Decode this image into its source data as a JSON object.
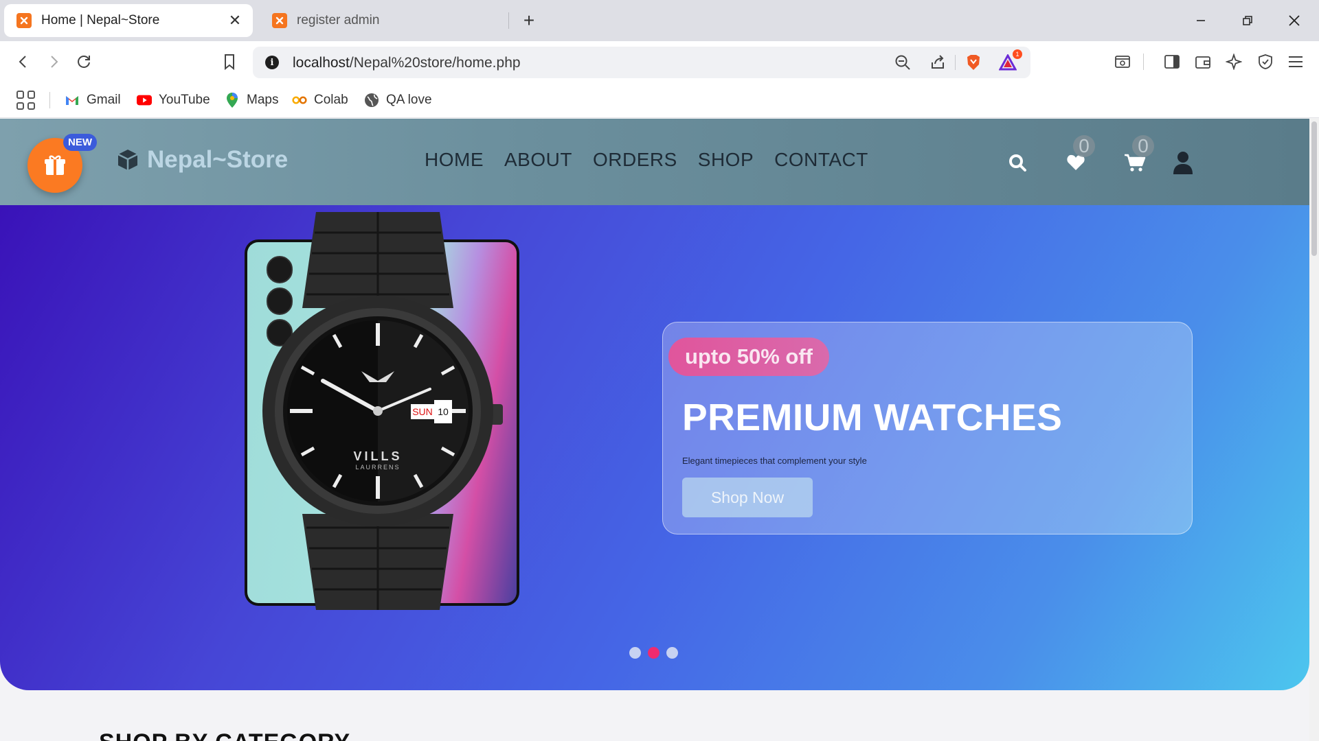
{
  "browser": {
    "tabs": [
      {
        "title": "Home | Nepal~Store",
        "active": true
      },
      {
        "title": "register admin",
        "active": false
      }
    ],
    "url_host": "localhost",
    "url_path": "/Nepal%20store/home.php",
    "brave_badge_count": "1",
    "bookmarks": [
      {
        "label": "Gmail",
        "icon": "gmail-icon"
      },
      {
        "label": "YouTube",
        "icon": "youtube-icon"
      },
      {
        "label": "Maps",
        "icon": "maps-icon"
      },
      {
        "label": "Colab",
        "icon": "colab-icon"
      },
      {
        "label": "QA love",
        "icon": "globe-icon"
      }
    ]
  },
  "site": {
    "badge_label": "NEW",
    "logo_text": "Nepal~Store",
    "nav": [
      "HOME",
      "ABOUT",
      "ORDERS",
      "SHOP",
      "CONTACT"
    ],
    "wishlist_count": "0",
    "cart_count": "0"
  },
  "hero": {
    "discount": "upto 50% off",
    "title": "PREMIUM WATCHES",
    "subtitle": "Elegant timepieces that complement your style",
    "cta": "Shop Now",
    "slides": 3,
    "active_slide": 2,
    "watch": {
      "brand": "VILLS",
      "brand_sub": "LAURRENS",
      "day": "SUN",
      "date": "10"
    }
  },
  "section": {
    "title": "SHOP BY CATEGORY"
  },
  "colors": {
    "accent_orange": "#fb7a22",
    "active_dot": "#ef2b6f",
    "header_teal": "#6b8f9d"
  }
}
